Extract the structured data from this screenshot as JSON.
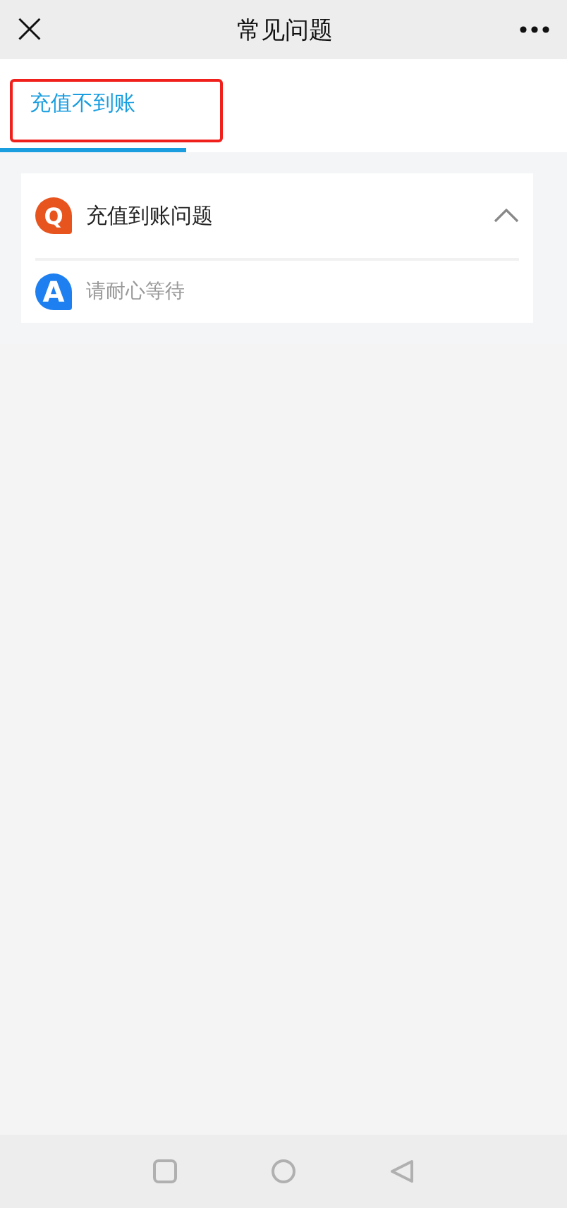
{
  "header": {
    "title": "常见问题",
    "close_icon": "×"
  },
  "tabs": [
    {
      "label": "充值不到账",
      "selected": true,
      "highlighted": true
    }
  ],
  "faq": [
    {
      "question_mark": "Q",
      "question": "充值到账问题",
      "answer_mark": "A",
      "answer": "请耐心等待",
      "expanded": true
    }
  ]
}
